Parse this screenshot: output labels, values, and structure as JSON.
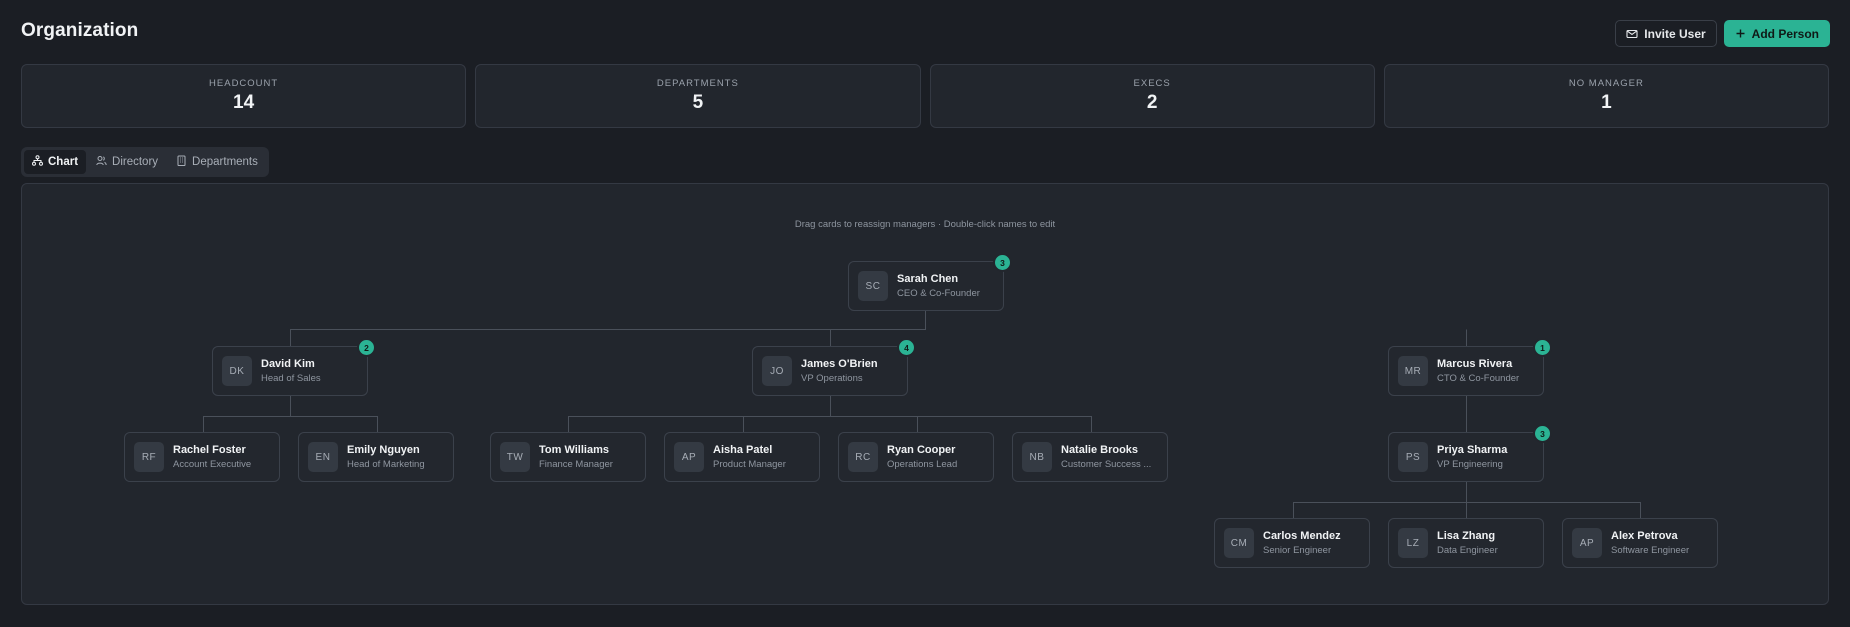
{
  "header": {
    "title": "Organization",
    "invite_label": "Invite User",
    "add_label": "Add Person"
  },
  "stats": [
    {
      "label": "HEADCOUNT",
      "value": "14"
    },
    {
      "label": "DEPARTMENTS",
      "value": "5"
    },
    {
      "label": "EXECS",
      "value": "2"
    },
    {
      "label": "NO MANAGER",
      "value": "1"
    }
  ],
  "tabs": [
    {
      "label": "Chart",
      "icon": "org-chart-icon",
      "active": true
    },
    {
      "label": "Directory",
      "icon": "users-icon",
      "active": false
    },
    {
      "label": "Departments",
      "icon": "building-icon",
      "active": false
    }
  ],
  "chart": {
    "hint": "Drag cards to reassign managers · Double-click names to edit",
    "nodes": {
      "sc": {
        "initials": "SC",
        "name": "Sarah Chen",
        "role": "CEO & Co-Founder",
        "reports": "3"
      },
      "dk": {
        "initials": "DK",
        "name": "David Kim",
        "role": "Head of Sales",
        "reports": "2"
      },
      "jo": {
        "initials": "JO",
        "name": "James O'Brien",
        "role": "VP Operations",
        "reports": "4"
      },
      "mr": {
        "initials": "MR",
        "name": "Marcus Rivera",
        "role": "CTO & Co-Founder",
        "reports": "1"
      },
      "rf": {
        "initials": "RF",
        "name": "Rachel Foster",
        "role": "Account Executive"
      },
      "en": {
        "initials": "EN",
        "name": "Emily Nguyen",
        "role": "Head of Marketing"
      },
      "tw": {
        "initials": "TW",
        "name": "Tom Williams",
        "role": "Finance Manager"
      },
      "ap1": {
        "initials": "AP",
        "name": "Aisha Patel",
        "role": "Product Manager"
      },
      "rc": {
        "initials": "RC",
        "name": "Ryan Cooper",
        "role": "Operations Lead"
      },
      "nb": {
        "initials": "NB",
        "name": "Natalie Brooks",
        "role": "Customer Success ..."
      },
      "ps": {
        "initials": "PS",
        "name": "Priya Sharma",
        "role": "VP Engineering",
        "reports": "3"
      },
      "cm": {
        "initials": "CM",
        "name": "Carlos Mendez",
        "role": "Senior Engineer"
      },
      "lz": {
        "initials": "LZ",
        "name": "Lisa Zhang",
        "role": "Data Engineer"
      },
      "ap2": {
        "initials": "AP",
        "name": "Alex Petrova",
        "role": "Software Engineer"
      }
    }
  },
  "colors": {
    "background": "#1b1e24",
    "panel": "#22262d",
    "accent": "#2bb394",
    "connector": "#4a505a"
  }
}
